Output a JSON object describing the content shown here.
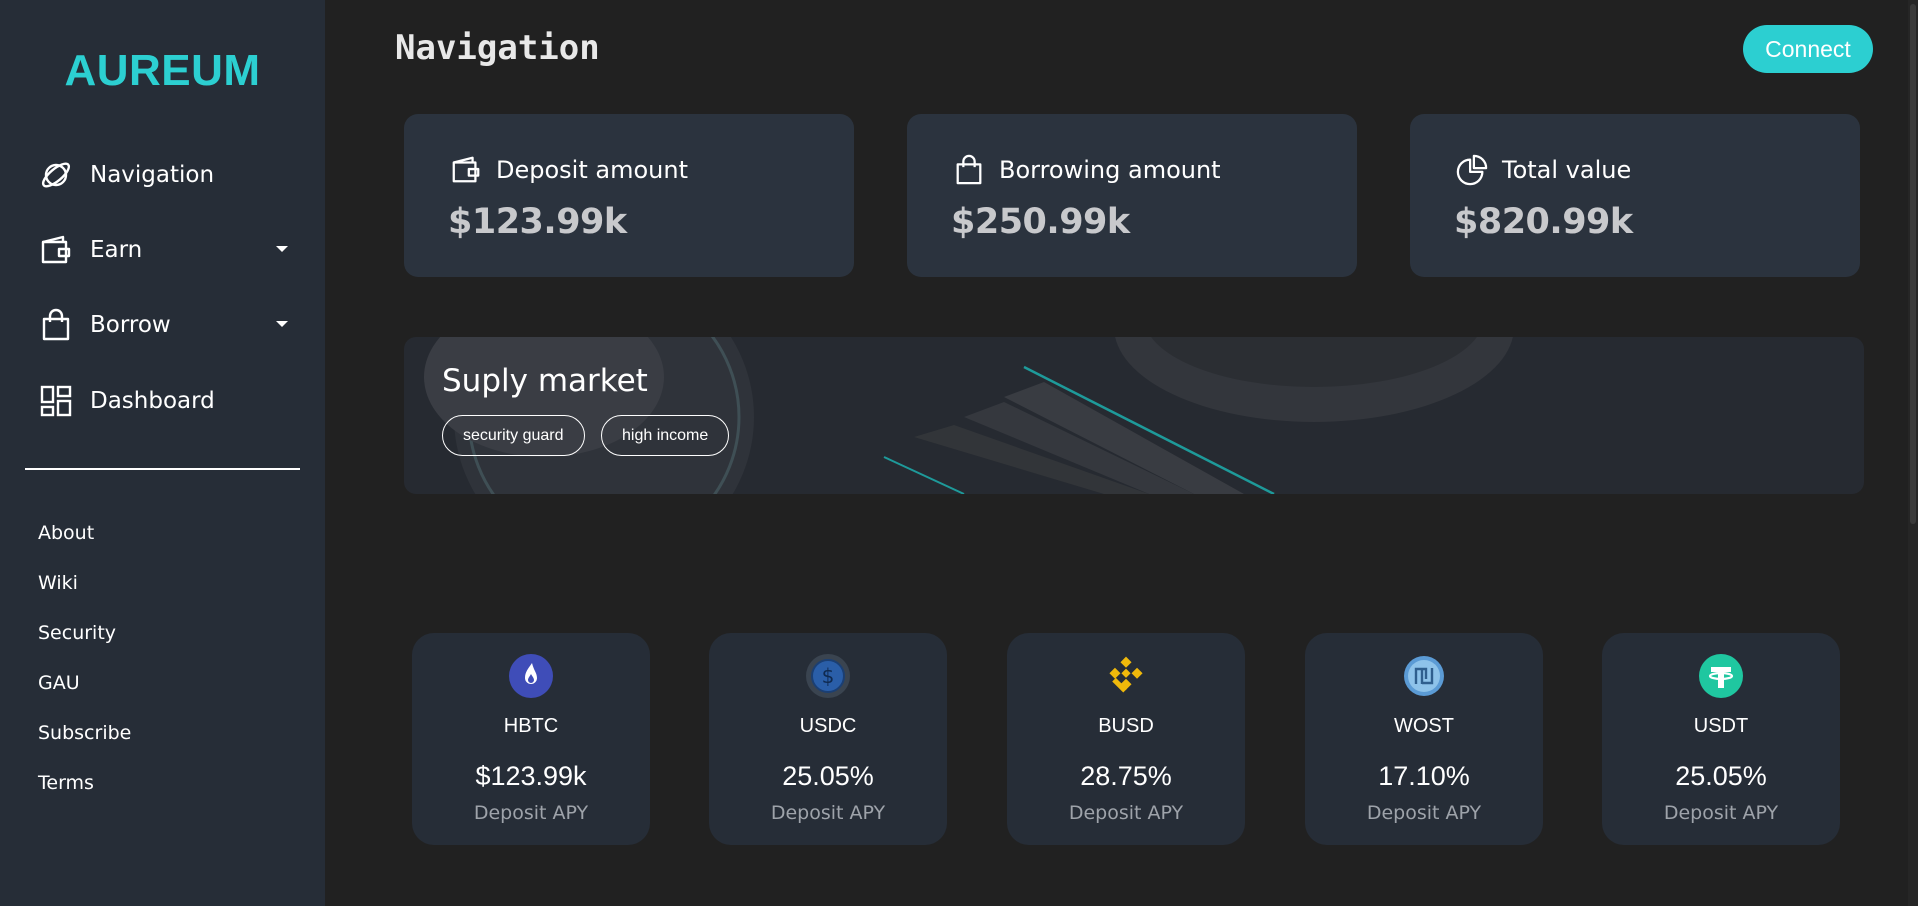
{
  "sidebar": {
    "logo": "AUREUM",
    "nav": [
      {
        "label": "Navigation",
        "icon": "planet-icon"
      },
      {
        "label": "Earn",
        "icon": "wallet-icon",
        "dropdown": true
      },
      {
        "label": "Borrow",
        "icon": "shopping-bag-icon",
        "dropdown": true
      },
      {
        "label": "Dashboard",
        "icon": "dashboard-icon"
      }
    ],
    "links": [
      "About",
      "Wiki",
      "Security",
      "GAU",
      "Subscribe",
      "Terms"
    ]
  },
  "header": {
    "title": "Navigation",
    "connect_label": "Connect"
  },
  "stats": [
    {
      "title": "Deposit amount",
      "value": "$123.99k",
      "icon": "wallet-icon"
    },
    {
      "title": "Borrowing amount",
      "value": "$250.99k",
      "icon": "shopping-bag-icon"
    },
    {
      "title": "Total value",
      "value": "$820.99k",
      "icon": "pie-chart-icon"
    }
  ],
  "banner": {
    "title": "Suply market",
    "tags": [
      "security guard",
      "high income"
    ]
  },
  "assets": [
    {
      "symbol": "HBTC",
      "value": "$123.99k",
      "label": "Deposit APY",
      "icon": "hbtc-coin-icon",
      "color": "#3f4db8"
    },
    {
      "symbol": "USDC",
      "value": "25.05%",
      "label": "Deposit APY",
      "icon": "usdc-coin-icon",
      "color": "#2a5ea8"
    },
    {
      "symbol": "BUSD",
      "value": "28.75%",
      "label": "Deposit APY",
      "icon": "busd-coin-icon",
      "color": "#f0b90b"
    },
    {
      "symbol": "WOST",
      "value": "17.10%",
      "label": "Deposit APY",
      "icon": "wost-coin-icon",
      "color": "#5b9bd5"
    },
    {
      "symbol": "USDT",
      "value": "25.05%",
      "label": "Deposit APY",
      "icon": "usdt-coin-icon",
      "color": "#1fc7a0"
    }
  ],
  "colors": {
    "accent": "#2ccfd1",
    "background": "#212121",
    "sidebar": "#262d37",
    "card": "#2b333e"
  }
}
